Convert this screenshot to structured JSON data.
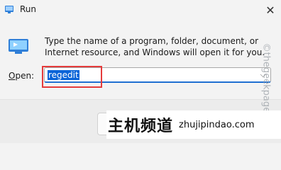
{
  "window": {
    "title": "Run",
    "close_glyph": "✕"
  },
  "icons": {
    "app": "run-app-icon",
    "dialog": "run-dialog-icon",
    "close": "close-icon",
    "dropdown": "chevron-down-icon"
  },
  "dialog": {
    "description": "Type the name of a program, folder, document, or Internet resource, and Windows will open it for you.",
    "open_label_mnemonic": "O",
    "open_label_rest": "pen:",
    "input_value": "regedit",
    "dropdown_glyph": "⌵"
  },
  "watermark": {
    "side_text": "©thegeekpage.c",
    "banner_cn": "主机频道",
    "banner_url": "zhujipindao.com"
  },
  "colors": {
    "selection": "#0a64d8",
    "highlight_box": "#e53b3b",
    "focus_underline": "#1f6fd1"
  }
}
